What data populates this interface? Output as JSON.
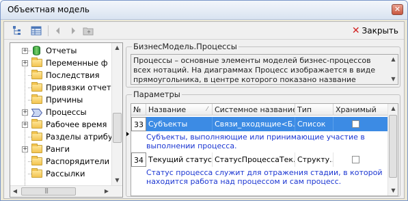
{
  "window": {
    "title": "Объектная модель",
    "close_glyph": "✕"
  },
  "toolbar": {
    "icons": [
      "tree-structure-icon",
      "table-grid-icon",
      "back-arrow-icon",
      "forward-arrow-icon",
      "folder-up-icon"
    ],
    "close_label": "Закрыть",
    "close_glyph": "✕"
  },
  "tree": {
    "items": [
      {
        "label": "Отчеты",
        "icon": "database-icon",
        "expandable": true
      },
      {
        "label": "Переменные ф",
        "icon": "folder-icon",
        "expandable": true
      },
      {
        "label": "Последствия",
        "icon": "folder-icon",
        "expandable": false
      },
      {
        "label": "Привязки отчет",
        "icon": "folder-icon",
        "expandable": false
      },
      {
        "label": "Причины",
        "icon": "folder-icon",
        "expandable": false
      },
      {
        "label": "Процессы",
        "icon": "process-icon",
        "expandable": true
      },
      {
        "label": "Рабочее время",
        "icon": "folder-icon",
        "expandable": true
      },
      {
        "label": "Разделы атрибу",
        "icon": "folder-icon",
        "expandable": false
      },
      {
        "label": "Ранги",
        "icon": "folder-icon",
        "expandable": true
      },
      {
        "label": "Распорядители",
        "icon": "folder-icon",
        "expandable": false
      },
      {
        "label": "Рассылки",
        "icon": "folder-icon",
        "expandable": false
      }
    ]
  },
  "description": {
    "title": "БизнесМодель.Процессы",
    "text": "Процессы – основные элементы моделей бизнес-процессов всех нотаций. На диаграммах Процесс изображается в виде прямоугольника, в центре которого показано название Процесса."
  },
  "parameters": {
    "title": "Параметры",
    "columns": [
      "№",
      "Название",
      "Системное название",
      "Тип",
      "Хранимый"
    ],
    "rows": [
      {
        "num": "33",
        "name": "Субъекты",
        "system_name": "Связи_входящие<Б...",
        "type": "Список",
        "stored": false,
        "description": "Субъекты, выполняющие  или принимающие участие в выполнении процесса.",
        "selected": true
      },
      {
        "num": "34",
        "name": "Текущий статус",
        "system_name": "СтатусПроцессаТек...",
        "type": "Структу...",
        "stored": false,
        "description": "Статус процесса служит для отражения стадии, в которой находится работа над процессом и сам процесс.",
        "selected": false
      }
    ]
  },
  "colors": {
    "selection": "#3c8be4",
    "description_text": "#1b36d2",
    "close_red": "#d21f1f"
  }
}
